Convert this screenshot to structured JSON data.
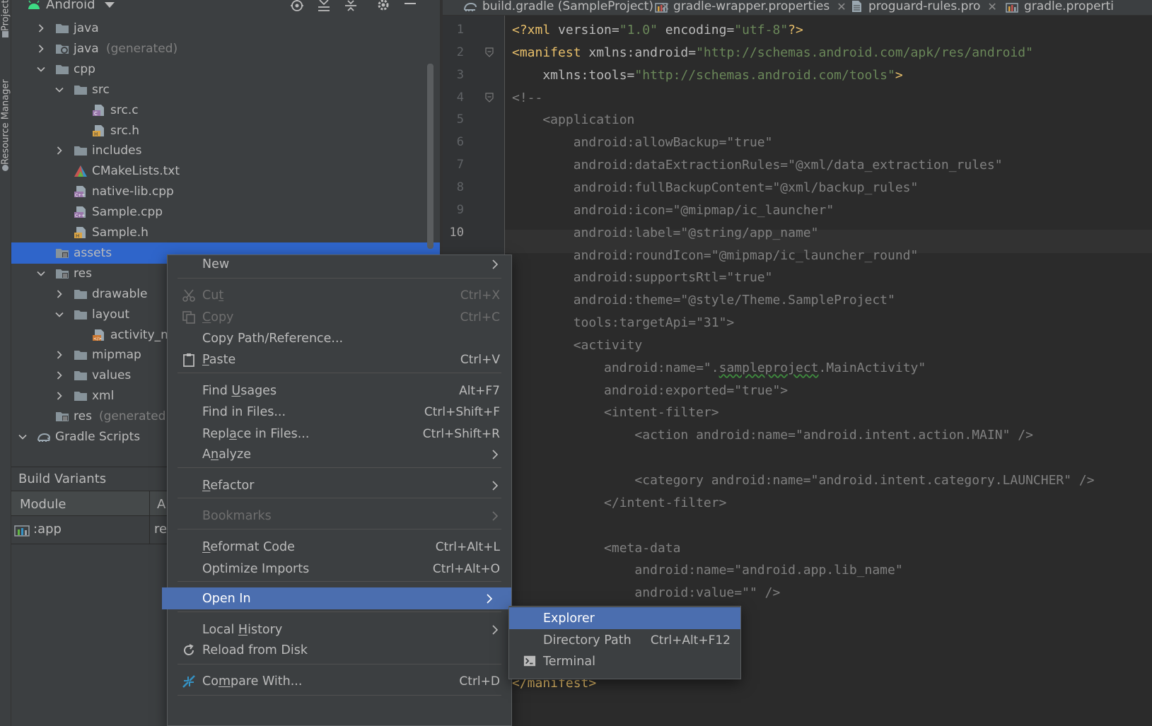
{
  "tool_strip": {
    "project_tab": "Project",
    "resource_manager_tab": "Resource Manager"
  },
  "project_panel": {
    "view_selector": "Android",
    "tree": [
      {
        "label": "java",
        "suffix": "",
        "icon": "folder-icon",
        "arrow": "collapsed"
      },
      {
        "label": "java",
        "suffix": "(generated)",
        "icon": "generated-folder-icon",
        "arrow": "collapsed"
      },
      {
        "label": "cpp",
        "suffix": "",
        "icon": "folder-icon",
        "arrow": "expanded"
      },
      {
        "label": "src",
        "suffix": "",
        "icon": "folder-icon",
        "arrow": "expanded"
      },
      {
        "label": "src.c",
        "suffix": "",
        "icon": "c-file-icon",
        "arrow": "none"
      },
      {
        "label": "src.h",
        "suffix": "",
        "icon": "h-file-icon",
        "arrow": "none"
      },
      {
        "label": "includes",
        "suffix": "",
        "icon": "folder-icon",
        "arrow": "collapsed"
      },
      {
        "label": "CMakeLists.txt",
        "suffix": "",
        "icon": "cmake-icon",
        "arrow": "none"
      },
      {
        "label": "native-lib.cpp",
        "suffix": "",
        "icon": "cpp-file-icon",
        "arrow": "none"
      },
      {
        "label": "Sample.cpp",
        "suffix": "",
        "icon": "cpp-file-icon",
        "arrow": "none"
      },
      {
        "label": "Sample.h",
        "suffix": "",
        "icon": "h-file-icon",
        "arrow": "none"
      },
      {
        "label": "assets",
        "suffix": "",
        "icon": "resource-folder-icon",
        "arrow": "none"
      },
      {
        "label": "res",
        "suffix": "",
        "icon": "resource-folder-icon",
        "arrow": "expanded"
      },
      {
        "label": "drawable",
        "suffix": "",
        "icon": "folder-icon",
        "arrow": "collapsed"
      },
      {
        "label": "layout",
        "suffix": "",
        "icon": "folder-icon",
        "arrow": "expanded"
      },
      {
        "label": "activity_m",
        "suffix": "",
        "icon": "layout-xml-icon",
        "arrow": "none"
      },
      {
        "label": "mipmap",
        "suffix": "",
        "icon": "folder-icon",
        "arrow": "collapsed"
      },
      {
        "label": "values",
        "suffix": "",
        "icon": "folder-icon",
        "arrow": "collapsed"
      },
      {
        "label": "xml",
        "suffix": "",
        "icon": "folder-icon",
        "arrow": "collapsed"
      },
      {
        "label": "res",
        "suffix": "(generated)",
        "icon": "resource-folder-icon",
        "arrow": "none"
      },
      {
        "label": "Gradle Scripts",
        "suffix": "",
        "icon": "gradle-icon",
        "arrow": "expanded"
      }
    ],
    "selected_item": "assets",
    "build_variants": {
      "title": "Build Variants",
      "columns": [
        "Module",
        "A"
      ],
      "rows": [
        {
          "module": ":app",
          "variant": "re"
        }
      ]
    }
  },
  "editor": {
    "tabs": [
      {
        "label": "build.gradle (SampleProject)",
        "icon": "gradle-icon",
        "closable": true
      },
      {
        "label": "gradle-wrapper.properties",
        "icon": "properties-icon",
        "closable": true
      },
      {
        "label": "proguard-rules.pro",
        "icon": "text-file-icon",
        "closable": true
      },
      {
        "label": "gradle.properti",
        "icon": "properties-icon",
        "closable": false
      }
    ],
    "current_line": 10,
    "line_numbers": [
      "1",
      "2",
      "3",
      "4",
      "5",
      "6",
      "7",
      "8",
      "9",
      "10"
    ],
    "lines": [
      [
        [
          "pi",
          "<?xml "
        ],
        [
          "attr",
          "version="
        ],
        [
          "val",
          "\"1.0\""
        ],
        [
          "attr",
          " encoding="
        ],
        [
          "val",
          "\"utf-8\""
        ],
        [
          "pi",
          "?>"
        ]
      ],
      [
        [
          "tag",
          "<manifest "
        ],
        [
          "attr",
          "xmlns:android="
        ],
        [
          "val",
          "\"http://schemas.android.com/apk/res/android\""
        ]
      ],
      [
        [
          "attr",
          "    xmlns:tools="
        ],
        [
          "val",
          "\"http://schemas.android.com/tools\""
        ],
        [
          "tag",
          ">"
        ]
      ],
      [
        [
          "com",
          "<!--"
        ]
      ],
      [
        [
          "com",
          "    <application"
        ]
      ],
      [
        [
          "com",
          "        android:allowBackup=\"true\""
        ]
      ],
      [
        [
          "com",
          "        android:dataExtractionRules=\"@xml/data_extraction_rules\""
        ]
      ],
      [
        [
          "com",
          "        android:fullBackupContent=\"@xml/backup_rules\""
        ]
      ],
      [
        [
          "com",
          "        android:icon=\"@mipmap/ic_launcher\""
        ]
      ],
      [
        [
          "com",
          "        android:label=\"@string/app_name\""
        ]
      ],
      [
        [
          "com",
          "        android:roundIcon=\"@mipmap/ic_launcher_round\""
        ]
      ],
      [
        [
          "com",
          "        android:supportsRtl=\"true\""
        ]
      ],
      [
        [
          "com",
          "        android:theme=\"@style/Theme.SampleProject\""
        ]
      ],
      [
        [
          "com",
          "        tools:targetApi=\"31\">"
        ]
      ],
      [
        [
          "com",
          "        <activity"
        ]
      ],
      [
        [
          "com",
          "            android:name=\"."
        ],
        [
          "sq",
          "sampleproject"
        ],
        [
          "com",
          ".MainActivity\""
        ]
      ],
      [
        [
          "com",
          "            android:exported=\"true\">"
        ]
      ],
      [
        [
          "com",
          "            <intent-filter>"
        ]
      ],
      [
        [
          "com",
          "                <action android:name=\"android.intent.action.MAIN\" />"
        ]
      ],
      [
        [
          "com",
          ""
        ]
      ],
      [
        [
          "com",
          "                <category android:name=\"android.intent.category.LAUNCHER\" />"
        ]
      ],
      [
        [
          "com",
          "            </intent-filter>"
        ]
      ],
      [
        [
          "com",
          ""
        ]
      ],
      [
        [
          "com",
          "            <meta-data"
        ]
      ],
      [
        [
          "com",
          "                android:name=\"android.app.lib_name\""
        ]
      ],
      [
        [
          "com",
          "                android:value=\"\" />"
        ]
      ],
      [
        [
          "com",
          ""
        ]
      ],
      [
        [
          "com",
          ""
        ]
      ],
      [
        [
          "com",
          "-->"
        ]
      ],
      [
        [
          "tag",
          "</manifest>"
        ]
      ]
    ]
  },
  "context_menu": {
    "items": [
      {
        "type": "item",
        "label": "New",
        "shortcut": "",
        "submenu": true,
        "state": "normal",
        "icon": ""
      },
      {
        "type": "sep"
      },
      {
        "type": "item",
        "label": "Cut",
        "shortcut": "Ctrl+X",
        "submenu": false,
        "state": "disabled",
        "icon": "scissors-icon"
      },
      {
        "type": "item",
        "label": "Copy",
        "shortcut": "Ctrl+C",
        "submenu": false,
        "state": "disabled",
        "icon": "copy-icon"
      },
      {
        "type": "item",
        "label": "Copy Path/Reference...",
        "shortcut": "",
        "submenu": false,
        "state": "normal",
        "icon": ""
      },
      {
        "type": "item",
        "label": "Paste",
        "shortcut": "Ctrl+V",
        "submenu": false,
        "state": "normal",
        "icon": "clipboard-icon"
      },
      {
        "type": "sep"
      },
      {
        "type": "item",
        "label": "Find Usages",
        "shortcut": "Alt+F7",
        "submenu": false,
        "state": "normal",
        "icon": ""
      },
      {
        "type": "item",
        "label": "Find in Files...",
        "shortcut": "Ctrl+Shift+F",
        "submenu": false,
        "state": "normal",
        "icon": ""
      },
      {
        "type": "item",
        "label": "Replace in Files...",
        "shortcut": "Ctrl+Shift+R",
        "submenu": false,
        "state": "normal",
        "icon": ""
      },
      {
        "type": "item",
        "label": "Analyze",
        "shortcut": "",
        "submenu": true,
        "state": "normal",
        "icon": ""
      },
      {
        "type": "sep"
      },
      {
        "type": "item",
        "label": "Refactor",
        "shortcut": "",
        "submenu": true,
        "state": "normal",
        "icon": ""
      },
      {
        "type": "sep"
      },
      {
        "type": "item",
        "label": "Bookmarks",
        "shortcut": "",
        "submenu": true,
        "state": "disabled",
        "icon": ""
      },
      {
        "type": "sep"
      },
      {
        "type": "item",
        "label": "Reformat Code",
        "shortcut": "Ctrl+Alt+L",
        "submenu": false,
        "state": "normal",
        "icon": ""
      },
      {
        "type": "item",
        "label": "Optimize Imports",
        "shortcut": "Ctrl+Alt+O",
        "submenu": false,
        "state": "normal",
        "icon": ""
      },
      {
        "type": "sep"
      },
      {
        "type": "item",
        "label": "Open In",
        "shortcut": "",
        "submenu": true,
        "state": "active",
        "icon": ""
      },
      {
        "type": "sep"
      },
      {
        "type": "item",
        "label": "Local History",
        "shortcut": "",
        "submenu": true,
        "state": "normal",
        "icon": ""
      },
      {
        "type": "item",
        "label": "Reload from Disk",
        "shortcut": "",
        "submenu": false,
        "state": "normal",
        "icon": "reload-icon"
      },
      {
        "type": "sep"
      },
      {
        "type": "item",
        "label": "Compare With...",
        "shortcut": "Ctrl+D",
        "submenu": false,
        "state": "normal",
        "icon": "compare-icon"
      },
      {
        "type": "sep"
      }
    ]
  },
  "open_in_submenu": {
    "items": [
      {
        "label": "Explorer",
        "shortcut": "",
        "state": "active",
        "icon": ""
      },
      {
        "label": "Directory Path",
        "shortcut": "Ctrl+Alt+F12",
        "state": "normal",
        "icon": ""
      },
      {
        "label": "Terminal",
        "shortcut": "",
        "state": "normal",
        "icon": "terminal-icon"
      }
    ]
  },
  "colors": {
    "selection": "#2f65ca",
    "menu_active": "#4b6eaf",
    "panel_bg": "#3c3f41",
    "editor_bg": "#2b2b2b",
    "xml_tag": "#e8bf6a",
    "xml_value": "#6a8759",
    "comment": "#808080"
  }
}
